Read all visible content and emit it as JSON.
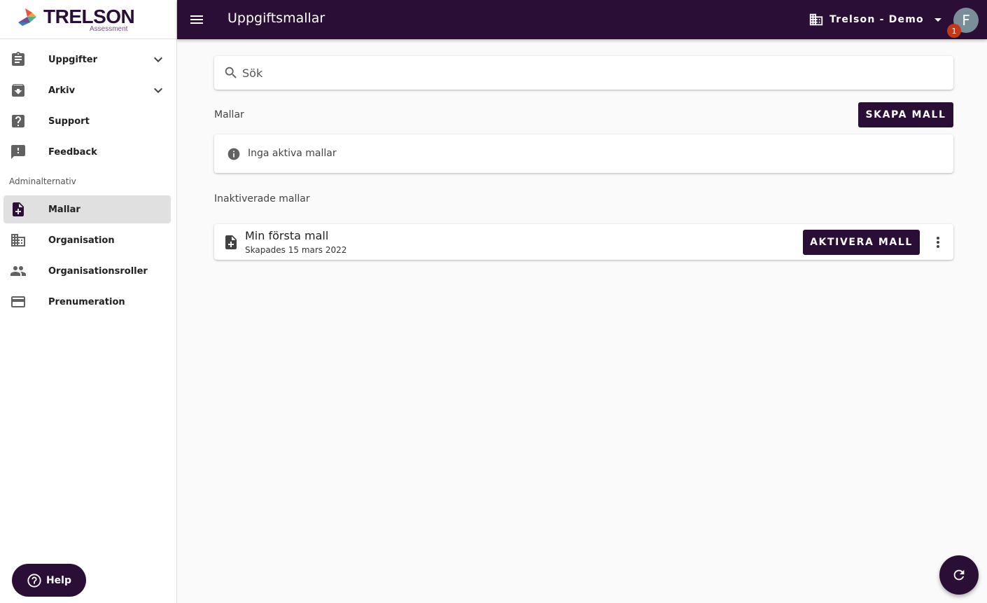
{
  "brand": {
    "name": "TRELSON",
    "sub": "Assessment"
  },
  "sidebar": {
    "items": [
      {
        "label": "Uppgifter",
        "icon": "clipboard-icon",
        "expandable": true
      },
      {
        "label": "Arkiv",
        "icon": "archive-icon",
        "expandable": true
      },
      {
        "label": "Support",
        "icon": "help-box-icon"
      },
      {
        "label": "Feedback",
        "icon": "feedback-icon"
      }
    ],
    "admin_label": "Adminalternativ",
    "admin_items": [
      {
        "label": "Mallar",
        "icon": "note-add-icon",
        "active": true
      },
      {
        "label": "Organisation",
        "icon": "business-icon"
      },
      {
        "label": "Organisationsroller",
        "icon": "people-icon"
      },
      {
        "label": "Prenumeration",
        "icon": "credit-card-icon"
      }
    ],
    "help_label": "Help"
  },
  "topbar": {
    "title": "Uppgiftsmallar",
    "org": "Trelson - Demo",
    "avatar_initial": "F",
    "notification_count": "1"
  },
  "search": {
    "placeholder": "Sök"
  },
  "templates": {
    "heading": "Mallar",
    "create_label": "SKAPA MALL",
    "empty_message": "Inga aktiva mallar"
  },
  "inactive": {
    "heading": "Inaktiverade mallar",
    "items": [
      {
        "name": "Min första mall",
        "created": "Skapades 15 mars 2022",
        "action_label": "AKTIVERA MALL"
      }
    ]
  },
  "colors": {
    "primary": "#2a0e36",
    "badge": "#c0391b",
    "avatar": "#7a8e9a"
  }
}
